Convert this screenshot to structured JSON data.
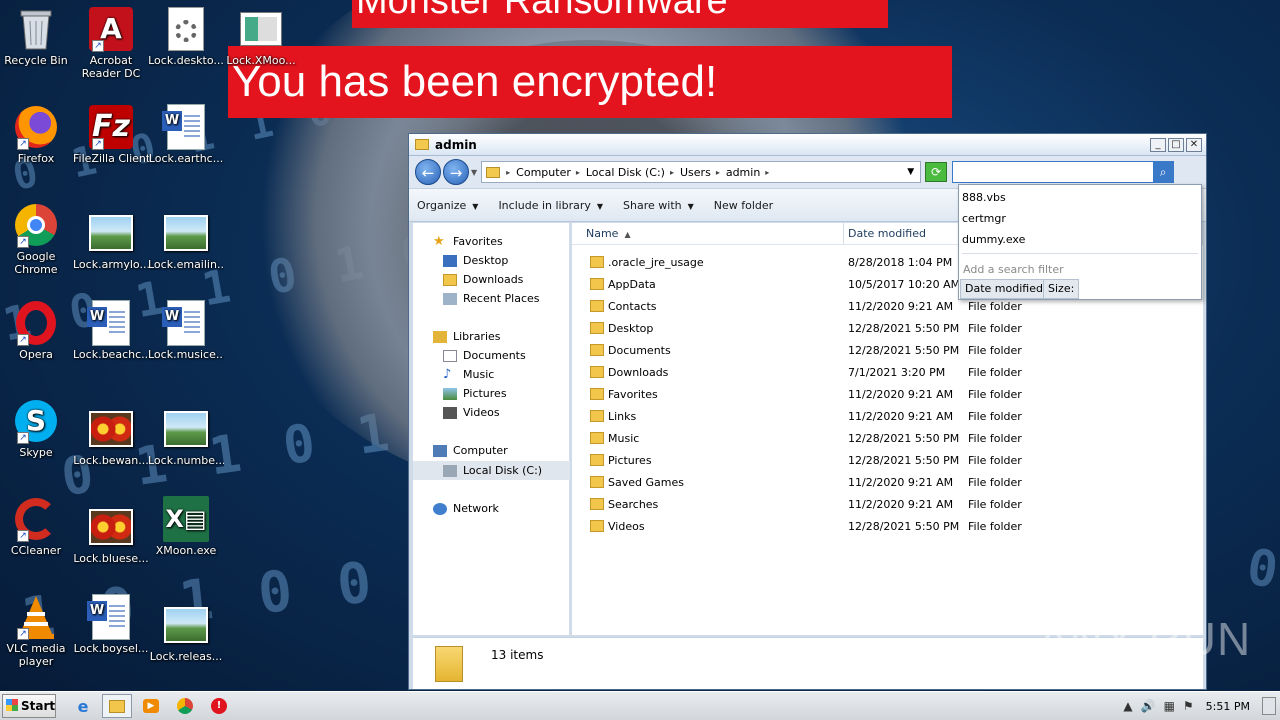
{
  "banners": {
    "top": "Monster Ransomware",
    "main": "You has been encrypted!"
  },
  "desktop_icons": [
    {
      "label": "Recycle Bin",
      "icon": "recycle-bin-icon"
    },
    {
      "label": "Acrobat Reader DC",
      "icon": "acrobat-icon"
    },
    {
      "label": "Lock.deskto...",
      "icon": "settings-file-icon"
    },
    {
      "label": "Lock.XMoo...",
      "icon": "file-thumbnail-icon"
    },
    {
      "label": "Firefox",
      "icon": "firefox-icon"
    },
    {
      "label": "FileZilla Client",
      "icon": "filezilla-icon"
    },
    {
      "label": "Lock.earthc...",
      "icon": "word-doc-icon"
    },
    {
      "label": "Google Chrome",
      "icon": "chrome-icon"
    },
    {
      "label": "Lock.armylo...",
      "icon": "image-file-icon"
    },
    {
      "label": "Lock.emailin...",
      "icon": "image-file-icon"
    },
    {
      "label": "Opera",
      "icon": "opera-icon"
    },
    {
      "label": "Lock.beachc...",
      "icon": "word-doc-icon"
    },
    {
      "label": "Lock.musice...",
      "icon": "word-doc-icon"
    },
    {
      "label": "Skype",
      "icon": "skype-icon"
    },
    {
      "label": "Lock.bewan...",
      "icon": "flower-image-icon"
    },
    {
      "label": "Lock.numbe...",
      "icon": "image-file-icon"
    },
    {
      "label": "CCleaner",
      "icon": "ccleaner-icon"
    },
    {
      "label": "Lock.bluese...",
      "icon": "flower-image-icon"
    },
    {
      "label": "XMoon.exe",
      "icon": "excel-exe-icon"
    },
    {
      "label": "VLC media player",
      "icon": "vlc-icon"
    },
    {
      "label": "Lock.boysel...",
      "icon": "word-doc-icon"
    },
    {
      "label": "Lock.releas...",
      "icon": "image-file-icon"
    }
  ],
  "window": {
    "title": "admin",
    "controls": {
      "minimize": "_",
      "maximize": "□",
      "close": "✕"
    },
    "breadcrumb": [
      "Computer",
      "Local Disk (C:)",
      "Users",
      "admin"
    ],
    "search": {
      "value": "",
      "placeholder": ""
    },
    "toolbar": {
      "organize": "Organize",
      "include_in_library": "Include in library",
      "share_with": "Share with",
      "new_folder": "New folder"
    },
    "nav": {
      "favorites": "Favorites",
      "desktop": "Desktop",
      "downloads": "Downloads",
      "recent_places": "Recent Places",
      "libraries": "Libraries",
      "documents": "Documents",
      "music": "Music",
      "pictures": "Pictures",
      "videos": "Videos",
      "computer": "Computer",
      "local_disk": "Local Disk (C:)",
      "network": "Network"
    },
    "columns": {
      "name": "Name",
      "date_modified": "Date modified"
    },
    "files": [
      {
        "name": ".oracle_jre_usage",
        "date": "8/28/2018 1:04 PM",
        "type": ""
      },
      {
        "name": "AppData",
        "date": "10/5/2017 10:20 AM",
        "type": ""
      },
      {
        "name": "Contacts",
        "date": "11/2/2020 9:21 AM",
        "type": "File folder"
      },
      {
        "name": "Desktop",
        "date": "12/28/2021 5:50 PM",
        "type": "File folder"
      },
      {
        "name": "Documents",
        "date": "12/28/2021 5:50 PM",
        "type": "File folder"
      },
      {
        "name": "Downloads",
        "date": "7/1/2021 3:20 PM",
        "type": "File folder"
      },
      {
        "name": "Favorites",
        "date": "11/2/2020 9:21 AM",
        "type": "File folder"
      },
      {
        "name": "Links",
        "date": "11/2/2020 9:21 AM",
        "type": "File folder"
      },
      {
        "name": "Music",
        "date": "12/28/2021 5:50 PM",
        "type": "File folder"
      },
      {
        "name": "Pictures",
        "date": "12/28/2021 5:50 PM",
        "type": "File folder"
      },
      {
        "name": "Saved Games",
        "date": "11/2/2020 9:21 AM",
        "type": "File folder"
      },
      {
        "name": "Searches",
        "date": "11/2/2020 9:21 AM",
        "type": "File folder"
      },
      {
        "name": "Videos",
        "date": "12/28/2021 5:50 PM",
        "type": "File folder"
      }
    ],
    "status": {
      "count": "13 items"
    }
  },
  "search_dropdown": {
    "suggestions": [
      "888.vbs",
      "certmgr",
      "dummy.exe"
    ],
    "hint": "Add a search filter",
    "filters": [
      "Date modified:",
      "Size:"
    ]
  },
  "taskbar": {
    "start": "Start",
    "clock": "5:51 PM"
  },
  "watermark": "ANY RUN"
}
